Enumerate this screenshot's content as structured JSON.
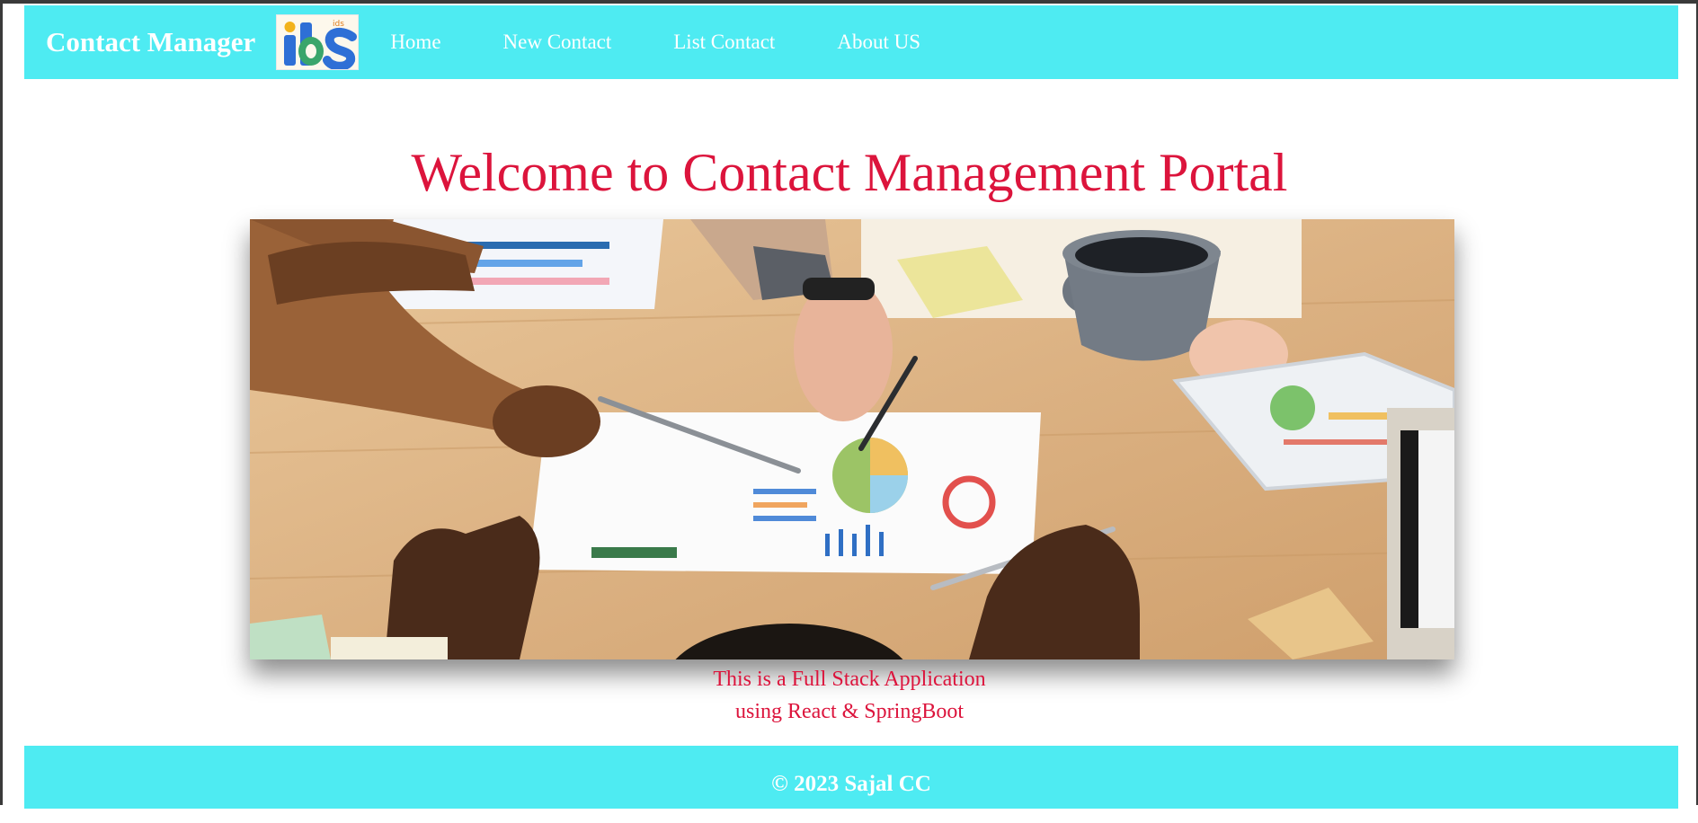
{
  "navbar": {
    "brand": "Contact Manager",
    "logo_text": "ids",
    "links": [
      "Home",
      "New Contact",
      "List Contact",
      "About US"
    ]
  },
  "main": {
    "heading": "Welcome to Contact Management Portal",
    "tagline_line1": "This is a Full Stack Application",
    "tagline_line2": "using React & SpringBoot"
  },
  "footer": {
    "copyright": "© 2023 Sajal CC"
  },
  "colors": {
    "accent": "#4eebf2",
    "heading": "#dc143c"
  }
}
